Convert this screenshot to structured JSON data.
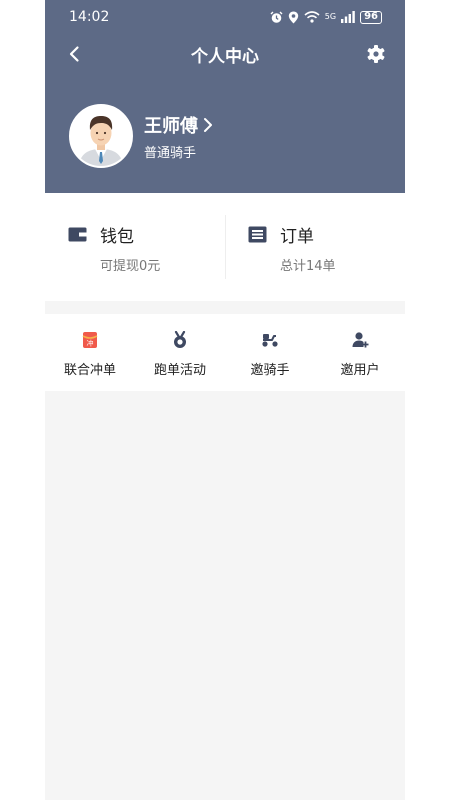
{
  "status_bar": {
    "time": "14:02",
    "network": "5G",
    "battery": "96",
    "icons": [
      "alarm-icon",
      "location-icon",
      "wifi-icon",
      "signal-icon",
      "battery-icon"
    ]
  },
  "nav": {
    "title": "个人中心",
    "back_icon": "chevron-left-icon",
    "settings_icon": "gear-icon"
  },
  "profile": {
    "name": "王师傅",
    "role": "普通骑手",
    "avatar_icon": "avatar-man-icon"
  },
  "stats": [
    {
      "title": "钱包",
      "subtitle": "可提现0元",
      "icon": "wallet-icon"
    },
    {
      "title": "订单",
      "subtitle": "总计14单",
      "icon": "order-list-icon"
    }
  ],
  "quick_actions": [
    {
      "label": "联合冲单",
      "icon": "red-packet-icon"
    },
    {
      "label": "跑单活动",
      "icon": "medal-icon"
    },
    {
      "label": "邀骑手",
      "icon": "scooter-icon"
    },
    {
      "label": "邀用户",
      "icon": "add-user-icon"
    }
  ],
  "quick_action_badge": "冲",
  "colors": {
    "header": "#5d6a86",
    "page_bg": "#f5f5f5",
    "icon_dark": "#3f4962",
    "accent_red": "#f05a4b"
  }
}
